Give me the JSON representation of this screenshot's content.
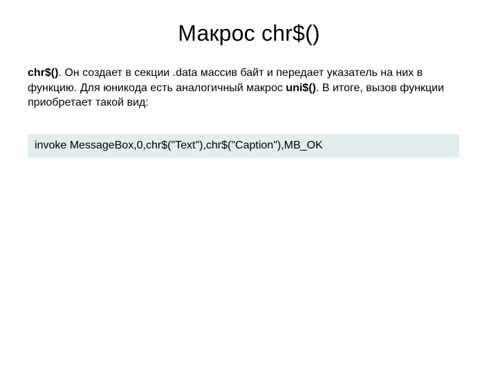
{
  "title": "Макрос chr$()",
  "paragraph": {
    "bold1": "chr$()",
    "text1": ". Он создает в секции .data массив байт и передает указатель на них в функцию. Для юникода есть аналогичный макрос ",
    "bold2": "uni$()",
    "text2": ". В итоге, вызов функции приобретает такой вид:"
  },
  "code": "invoke MessageBox,0,chr$(\"Text\"),chr$(\"Caption\"),MB_OK"
}
